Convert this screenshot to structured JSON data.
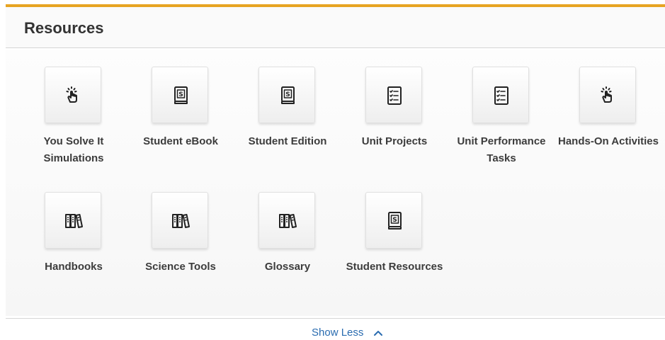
{
  "header": {
    "title": "Resources"
  },
  "resources": [
    {
      "label": "You Solve It Simulations",
      "icon": "hand-pointer-icon"
    },
    {
      "label": "Student eBook",
      "icon": "book-s-icon"
    },
    {
      "label": "Student Edition",
      "icon": "book-s-icon"
    },
    {
      "label": "Unit Projects",
      "icon": "checklist-icon"
    },
    {
      "label": "Unit Performance Tasks",
      "icon": "checklist-icon"
    },
    {
      "label": "Hands-On Activities",
      "icon": "hand-pointer-icon"
    },
    {
      "label": "Handbooks",
      "icon": "books-icon"
    },
    {
      "label": "Science Tools",
      "icon": "books-icon"
    },
    {
      "label": "Glossary",
      "icon": "books-icon"
    },
    {
      "label": "Student Resources",
      "icon": "book-s-icon"
    }
  ],
  "footer": {
    "toggle_label": "Show Less",
    "toggle_icon": "chevron-up-icon"
  },
  "colors": {
    "accent": "#e7a422",
    "link": "#2a6cb0",
    "text": "#333333"
  }
}
